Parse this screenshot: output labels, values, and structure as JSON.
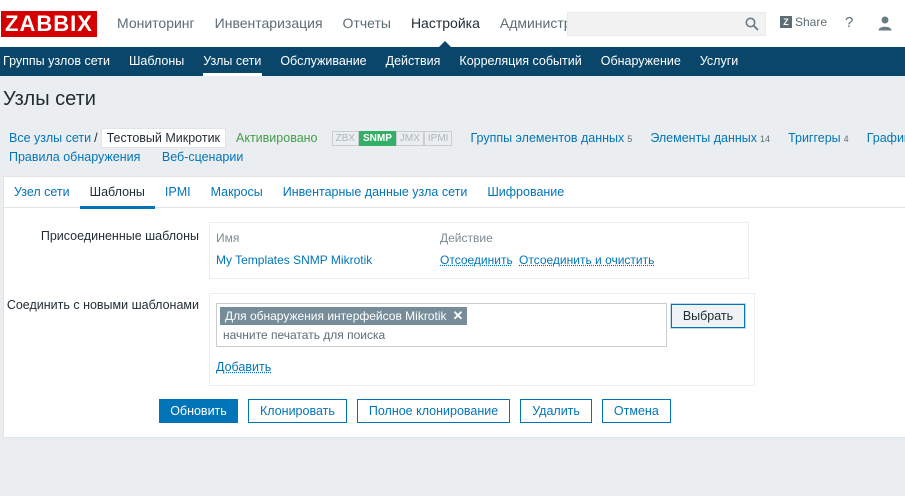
{
  "header": {
    "logo": "ZABBIX",
    "menu": [
      "Мониторинг",
      "Инвентаризация",
      "Отчеты",
      "Настройка",
      "Администр"
    ],
    "active_menu_index": 3,
    "share_label": "Share",
    "help_label": "?"
  },
  "subnav": {
    "items": [
      "Группы узлов сети",
      "Шаблоны",
      "Узлы сети",
      "Обслуживание",
      "Действия",
      "Корреляция событий",
      "Обнаружение",
      "Услуги"
    ],
    "active_index": 2
  },
  "page": {
    "title": "Узлы сети"
  },
  "breadcrumbs": {
    "all_hosts": "Все узлы сети",
    "separator": "/",
    "current_host": "Тестовый Микротик",
    "status": "Активировано",
    "availability": [
      "ZBX",
      "SNMP",
      "JMX",
      "IPMI"
    ],
    "availability_active": "SNMP",
    "items": [
      {
        "label": "Группы элементов данных",
        "count": "5"
      },
      {
        "label": "Элементы данных",
        "count": "14"
      },
      {
        "label": "Триггеры",
        "count": "4"
      },
      {
        "label": "График",
        "count": ""
      }
    ],
    "row2": [
      "Правила обнаружения",
      "Веб-сценарии"
    ]
  },
  "tabs": [
    "Узел сети",
    "Шаблоны",
    "IPMI",
    "Макросы",
    "Инвентарные данные узла сети",
    "Шифрование"
  ],
  "active_tab_index": 1,
  "form": {
    "linked_label": "Присоединенные шаблоны",
    "linked_table": {
      "col_name": "Имя",
      "col_action": "Действие",
      "row_name": "My Templates SNMP Mikrotik",
      "unlink": "Отсоединить",
      "unlink_clear": "Отсоединить и очистить"
    },
    "new_label": "Соединить с новыми шаблонами",
    "chip": "Для обнаружения интерфейсов Mikrotik",
    "chip_remove": "✕",
    "placeholder": "начните печатать для поиска",
    "select_button": "Выбрать",
    "add_link": "Добавить"
  },
  "buttons": {
    "update": "Обновить",
    "clone": "Клонировать",
    "full_clone": "Полное клонирование",
    "delete": "Удалить",
    "cancel": "Отмена"
  },
  "colors": {
    "nav_bg": "#0a466a",
    "link": "#0275b8",
    "logo_red": "#d40000",
    "status_green": "#429e47",
    "snmp_green": "#34af67"
  }
}
